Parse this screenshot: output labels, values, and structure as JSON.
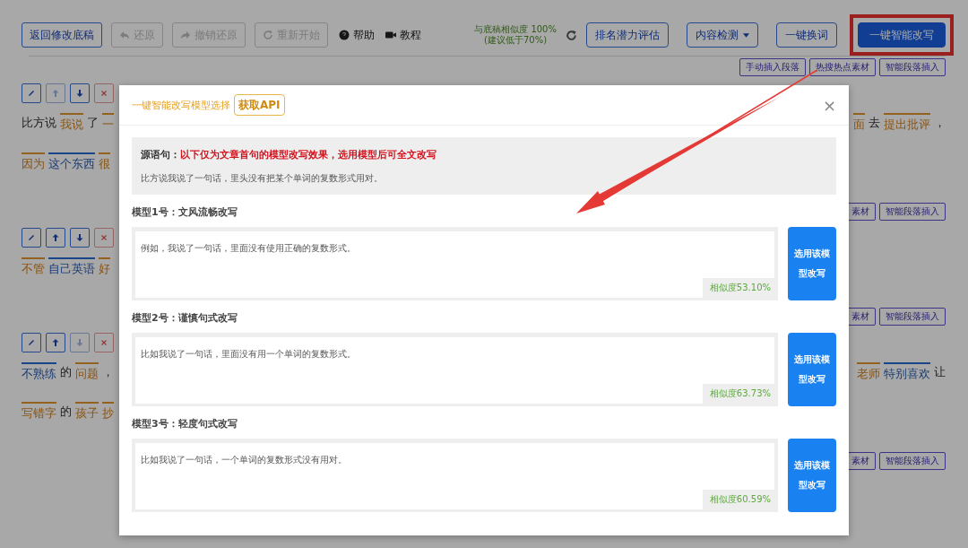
{
  "toolbar": {
    "left_buttons": [
      {
        "label": "返回修改底稿",
        "disabled": false,
        "kind": "text"
      },
      {
        "label": "还原",
        "disabled": true,
        "kind": "undo"
      },
      {
        "label": "撤销还原",
        "disabled": true,
        "kind": "redo"
      },
      {
        "label": "重新开始",
        "disabled": true,
        "kind": "restart"
      }
    ],
    "links": [
      {
        "label": "帮助",
        "kind": "help"
      },
      {
        "label": "教程",
        "kind": "tutorial"
      }
    ],
    "similarity": [
      "与底稿相似度 100%",
      "(建议低于70%)"
    ],
    "right_buttons": [
      {
        "label": "排名潜力评估",
        "kind": "outline",
        "highlighted": false
      },
      {
        "label": "内容检测",
        "kind": "dropdown",
        "highlighted": false
      },
      {
        "label": "一键换词",
        "kind": "outline",
        "highlighted": false
      },
      {
        "label": "一键智能改写",
        "kind": "primary",
        "highlighted": true
      }
    ]
  },
  "blocks": [
    {
      "insert_buttons": [
        "手动插入段落",
        "热搜热点素材",
        "智能段落插入"
      ],
      "tools": [
        {
          "kind": "edit",
          "disabled": false
        },
        {
          "kind": "up",
          "disabled": true
        },
        {
          "kind": "down",
          "disabled": false
        },
        {
          "kind": "delete",
          "disabled": false
        }
      ],
      "lines": [
        {
          "left": [
            {
              "t": "比方说",
              "kind": "plain"
            },
            {
              "t": "我说",
              "kind": "orange"
            },
            {
              "t": "了",
              "kind": "plain"
            },
            {
              "t": "一",
              "kind": "orange"
            }
          ],
          "right": [
            {
              "t": "面",
              "kind": "orange"
            },
            {
              "t": "去",
              "kind": "plain"
            },
            {
              "t": "提出批评",
              "kind": "orange"
            },
            {
              "t": "，",
              "kind": "plain"
            }
          ]
        },
        {
          "left": [
            {
              "t": "因为",
              "kind": "orange"
            },
            {
              "t": "这个东西",
              "kind": "blue"
            },
            {
              "t": "很",
              "kind": "orange"
            }
          ]
        }
      ]
    },
    {
      "insert_buttons": [
        "素材",
        "智能段落插入"
      ],
      "tools": [
        {
          "kind": "edit",
          "disabled": false
        },
        {
          "kind": "up",
          "disabled": false
        },
        {
          "kind": "down",
          "disabled": false
        },
        {
          "kind": "delete",
          "disabled": false
        }
      ],
      "lines": [
        {
          "left": [
            {
              "t": "不管",
              "kind": "orange"
            },
            {
              "t": "自己英语",
              "kind": "blue"
            },
            {
              "t": "好",
              "kind": "orange"
            }
          ]
        }
      ]
    },
    {
      "insert_buttons": [
        "素材",
        "智能段落插入"
      ],
      "tools": [
        {
          "kind": "edit",
          "disabled": false
        },
        {
          "kind": "up",
          "disabled": false
        },
        {
          "kind": "down",
          "disabled": true
        },
        {
          "kind": "delete",
          "disabled": false
        }
      ],
      "lines": [
        {
          "left": [
            {
              "t": "不熟练",
              "kind": "blue"
            },
            {
              "t": "的",
              "kind": "plain"
            },
            {
              "t": "问题",
              "kind": "orange"
            },
            {
              "t": "，",
              "kind": "plain"
            }
          ],
          "right": [
            {
              "t": "老师",
              "kind": "orange"
            },
            {
              "t": "特别喜欢",
              "kind": "blue"
            },
            {
              "t": "让",
              "kind": "plain"
            }
          ]
        },
        {
          "left": [
            {
              "t": "写错字",
              "kind": "orange"
            },
            {
              "t": "的",
              "kind": "plain"
            },
            {
              "t": "孩子",
              "kind": "orange"
            },
            {
              "t": "抄",
              "kind": "orange"
            }
          ]
        }
      ]
    },
    {
      "insert_buttons": [
        "素材",
        "智能段落插入"
      ]
    }
  ],
  "modal": {
    "title": "一键智能改写模型选择",
    "api_button": "获取API",
    "close": "×",
    "source": {
      "label": "源语句：",
      "note": "以下仅为文章首句的模型改写效果，选用模型后可全文改写",
      "text": "比方说我说了一句话，里头没有把某个单词的复数形式用对。"
    },
    "models": [
      {
        "label": "模型1号：文风流畅改写",
        "text": "例如，我说了一句话，里面没有使用正确的复数形式。",
        "similarity": "相似度53.10%",
        "button": "选用该模型改写"
      },
      {
        "label": "模型2号：谨慎句式改写",
        "text": "比如我说了一句话，里面没有用一个单词的复数形式。",
        "similarity": "相似度63.73%",
        "button": "选用该模型改写"
      },
      {
        "label": "模型3号：轻度句式改写",
        "text": "比如我说了一句话，一个单词的复数形式没有用对。",
        "similarity": "相似度60.59%",
        "button": "选用该模型改写"
      }
    ]
  }
}
